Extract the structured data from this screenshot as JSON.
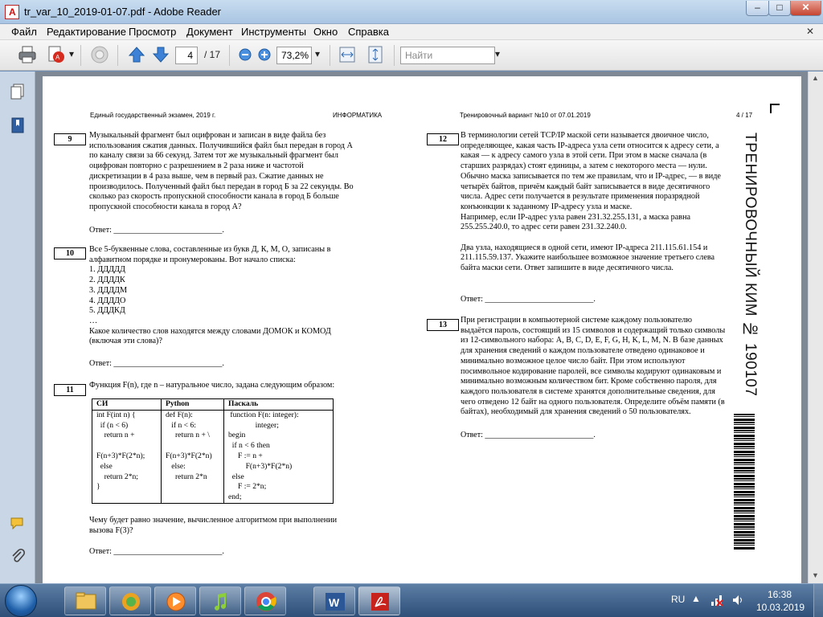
{
  "window": {
    "title": "tr_var_10_2019-01-07.pdf - Adobe Reader",
    "close_glyph": "✕",
    "min_glyph": "‒",
    "max_glyph": "□"
  },
  "menu": {
    "items": [
      "Файл",
      "Редактирование",
      "Просмотр",
      "Документ",
      "Инструменты",
      "Окно",
      "Справка"
    ],
    "close_glyph": "✕"
  },
  "toolbar": {
    "page_current": "4",
    "page_total": "/ 17",
    "zoom": "73,2%",
    "search_placeholder": "Найти"
  },
  "document": {
    "header_left": "Единый государственный экзамен, 2019 г.",
    "header_center": "ИНФОРМАТИКА",
    "header_right": "Тренировочный вариант №10 от 07.01.2019",
    "header_page": "4 / 17",
    "side_title": "ТРЕНИРОВОЧНЫЙ КИМ № 190107",
    "answer_label": "Ответ: ___________________________.",
    "questions": {
      "q9": {
        "num": "9",
        "text": " Музыкальный фрагмент был оцифрован и записан в виде файла без\nиспользования сжатия данных. Получившийся файл был передан в город А\nпо каналу связи за 66 секунд. Затем тот же музыкальный фрагмент был\nоцифрован повторно с разрешением в 2 раза ниже и частотой\nдискретизации в 4 раза выше, чем в первый раз. Сжатие данных не\nпроизводилось. Полученный файл был передан в город  Б за 22 секунды. Во\nсколько раз скорость пропускной способности канала в город Б больше\nпропускной способности канала в город А?"
      },
      "q10": {
        "num": "10",
        "text": " Все 5-буквенные слова, составленные из букв Д, К, М, О, записаны в\nалфавитном порядке и пронумерованы. Вот начало списка:\n1. ДДДДД\n2. ДДДДК\n3. ДДДДМ\n4. ДДДДО\n5. ДДДКД\n…\nКакое количество слов находятся между словами ДОМОК и КОМОД\n(включая эти слова)?"
      },
      "q11": {
        "num": "11",
        "text": "Функция F(n), где n – натуральное число, задана следующим образом:",
        "table": {
          "headers": [
            "СИ",
            "Python",
            "Паскаль"
          ],
          "cells": [
            "int F(int n) {\n  if (n < 6)\n    return n +\n\nF(n+3)*F(2*n);\n  else\n    return 2*n;\n}",
            "def F(n):\n   if n < 6:\n     return n + \\\n\nF(n+3)*F(2*n)\n   else:\n     return 2*n",
            " function F(n: integer):\n              integer;\nbegin\n  if n < 6 then\n     F := n +\n         F(n+3)*F(2*n)\n  else\n     F := 2*n;\nend;"
          ]
        },
        "question": "Чему будет равно значение, вычисленное алгоритмом при выполнении\nвызова F(3)?"
      },
      "q12": {
        "num": "12",
        "text": "В терминологии сетей TCP/IP маской сети называется двоичное число,\nопределяющее, какая часть IP-адреса узла сети относится к адресу сети, а\nкакая — к адресу самого узла в этой сети. При этом в маске сначала (в\nстарших разрядах) стоят единицы, а затем с некоторого места — нули.\nОбычно маска записывается по тем же правилам, что и IP-адрес, — в виде\nчетырёх байтов, причём каждый байт записывается в виде десятичного\nчисла. Адрес сети получается в результате применения поразрядной\nконъюнкции к заданному IP-адресу узла и маске.\nНапример, если IP-адрес узла равен 231.32.255.131, а маска равна\n255.255.240.0, то адрес сети равен 231.32.240.0.\n\nДва узла, находящиеся в одной сети, имеют IP-адреса 211.115.61.154 и\n211.115.59.137. Укажите наибольшее возможное значение третьего слева\nбайта маски сети. Ответ запишите в виде десятичного числа."
      },
      "q13": {
        "num": "13",
        "text": " При регистрации в компьютерной системе каждому пользователю\nвыдаётся пароль, состоящий из 15 символов и содержащий только символы\nиз 12-символьного набора: A, B, C, D, E, F, G, H, K, L, M, N. В базе данных\nдля хранения сведений о каждом пользователе отведено одинаковое и\nминимально возможное целое число байт. При этом используют\nпосимвольное кодирование паролей, все символы кодируют одинаковым и\nминимально возможным количеством бит. Кроме собственно пароля, для\nкаждого пользователя в системе хранятся дополнительные сведения, для\nчего отведено 12 байт на одного пользователя. Определите объём памяти (в\nбайтах), необходимый для хранения сведений о 50 пользователях."
      }
    }
  },
  "taskbar": {
    "language": "RU",
    "time": "16:38",
    "date": "10.03.2019"
  },
  "colors": {
    "taskbar": "#2d4f78",
    "titlebar": "#a9c5e3",
    "close_button": "#c6442f"
  }
}
